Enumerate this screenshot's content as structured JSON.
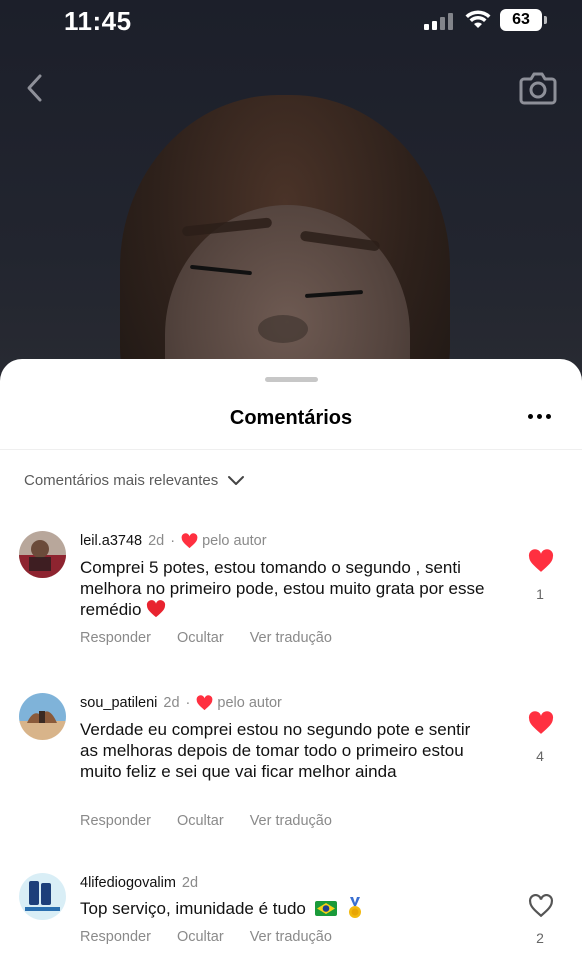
{
  "status_bar": {
    "time": "11:45",
    "battery": "63"
  },
  "sheet": {
    "title": "Comentários",
    "sort_label": "Comentários mais relevantes"
  },
  "colors": {
    "like_red": "#ff3040",
    "muted_text": "#8a8a8a"
  },
  "comments": [
    {
      "username": "leil.a3748",
      "time": "2d",
      "liked_by_author": true,
      "author_label": "pelo autor",
      "text": "Comprei 5 potes, estou tomando o segundo , senti melhora no primeiro pode, estou muito grata por esse remédio",
      "emoji": "heart",
      "liked": true,
      "likes": "1",
      "actions": [
        "Responder",
        "Ocultar",
        "Ver tradução"
      ]
    },
    {
      "username": "sou_patileni",
      "time": "2d",
      "liked_by_author": true,
      "author_label": "pelo autor",
      "text": "Verdade eu comprei estou no segundo pote e sentir as melhoras depois de tomar todo o primeiro estou muito feliz e sei que vai ficar melhor ainda",
      "liked": true,
      "likes": "4",
      "actions": [
        "Responder",
        "Ocultar",
        "Ver tradução"
      ]
    },
    {
      "username": "4lifediogovalim",
      "time": "2d",
      "liked_by_author": false,
      "text": "Top serviço, imunidade é tudo",
      "emoji": "brazil-flag medal",
      "liked": false,
      "likes": "2",
      "actions": [
        "Responder",
        "Ocultar",
        "Ver tradução"
      ]
    }
  ]
}
